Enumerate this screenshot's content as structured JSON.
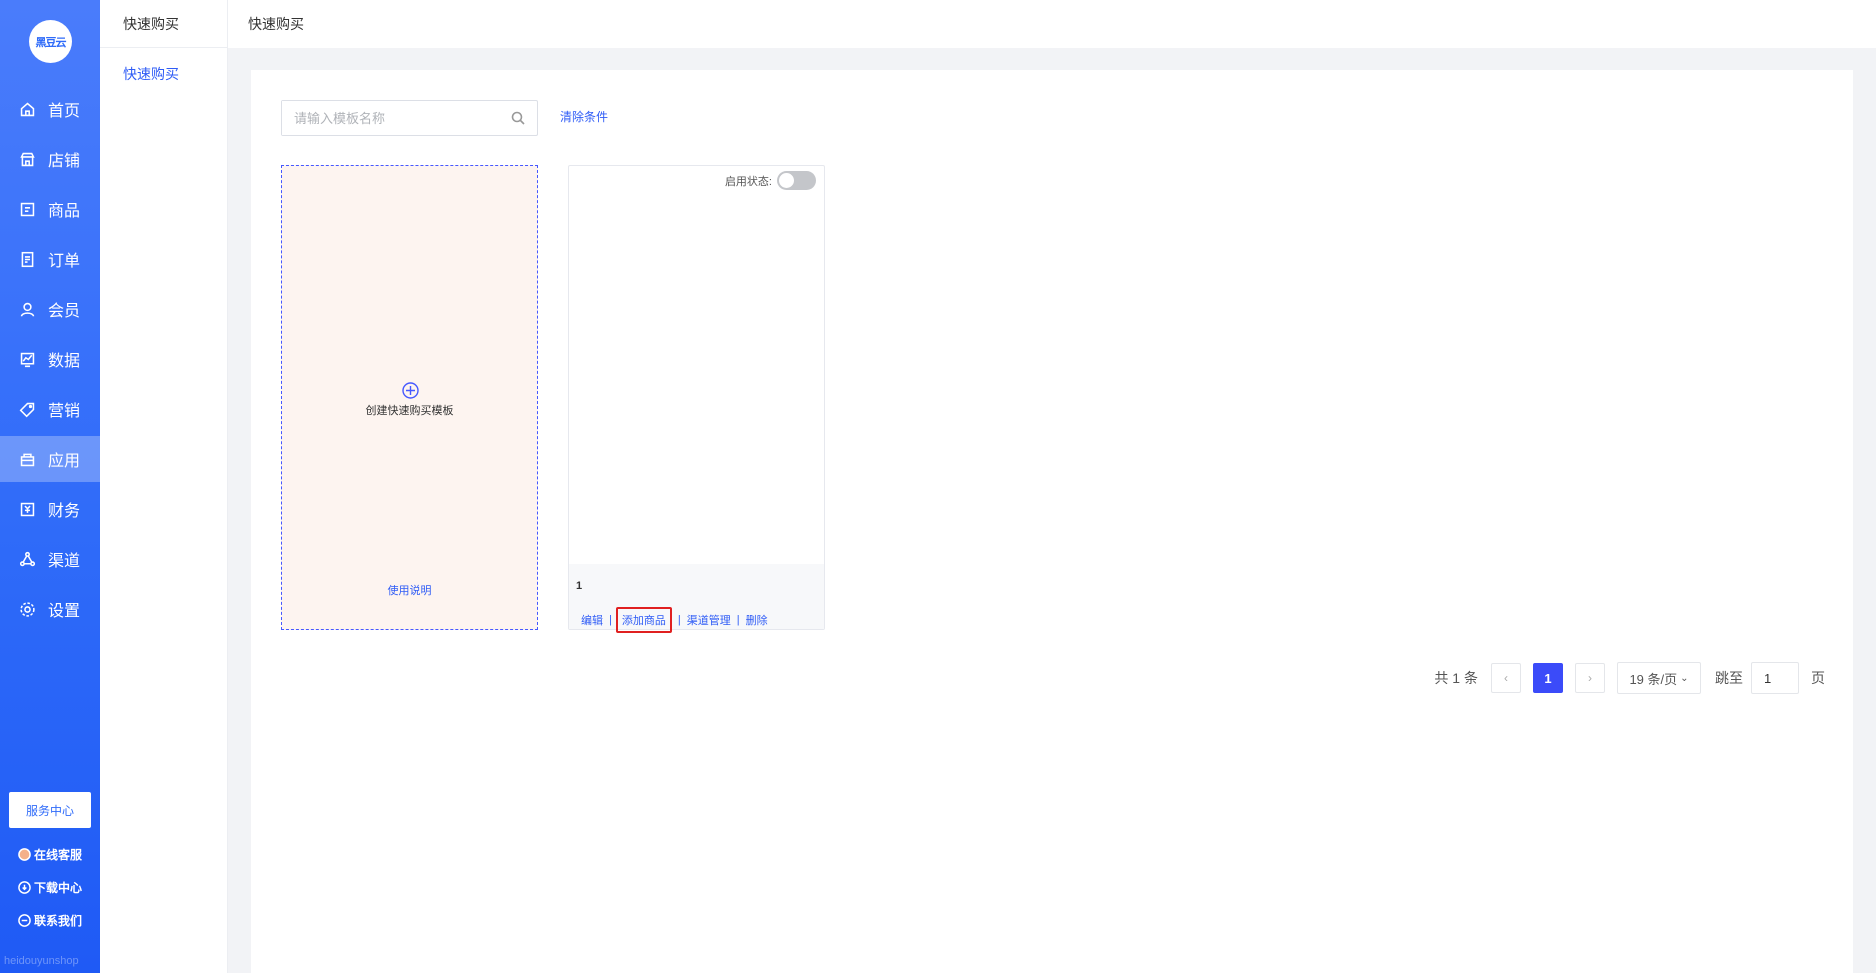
{
  "brand": {
    "logo_text": "黑豆云",
    "watermark": "heidouyunshop"
  },
  "nav": {
    "items": [
      {
        "label": "首页",
        "icon": "home-icon"
      },
      {
        "label": "店铺",
        "icon": "store-icon"
      },
      {
        "label": "商品",
        "icon": "goods-icon"
      },
      {
        "label": "订单",
        "icon": "order-icon"
      },
      {
        "label": "会员",
        "icon": "member-icon"
      },
      {
        "label": "数据",
        "icon": "chart-icon"
      },
      {
        "label": "营销",
        "icon": "tag-icon"
      },
      {
        "label": "应用",
        "icon": "app-icon",
        "active": true
      },
      {
        "label": "财务",
        "icon": "finance-icon"
      },
      {
        "label": "渠道",
        "icon": "channel-icon"
      },
      {
        "label": "设置",
        "icon": "gear-icon"
      }
    ],
    "service_center": "服务中心",
    "links": [
      {
        "label": "在线客服",
        "icon": "avatar-icon"
      },
      {
        "label": "下载中心",
        "icon": "download-icon"
      },
      {
        "label": "联系我们",
        "icon": "chat-icon"
      }
    ]
  },
  "subnav": {
    "header": "快速购买",
    "items": [
      "快速购买"
    ]
  },
  "topbar": {
    "breadcrumb": "快速购买"
  },
  "search": {
    "placeholder": "请输入模板名称",
    "value": ""
  },
  "clear_filters": "清除条件",
  "create_card": {
    "label": "创建快速购买模板",
    "help": "使用说明"
  },
  "template_card": {
    "status_label": "启用状态:",
    "enabled": false,
    "name": "1",
    "actions": [
      "编辑",
      "添加商品",
      "渠道管理",
      "删除"
    ]
  },
  "pagination": {
    "total": "共 1 条",
    "current_page": "1",
    "page_size": "19 条/页",
    "jump_label": "跳至",
    "jump_value": "1",
    "page_suffix": "页"
  },
  "colors": {
    "nav_bg": "#2f6bf9",
    "accent": "#3b4bf9",
    "link": "#2f5cf6",
    "highlight": "#e02020"
  }
}
